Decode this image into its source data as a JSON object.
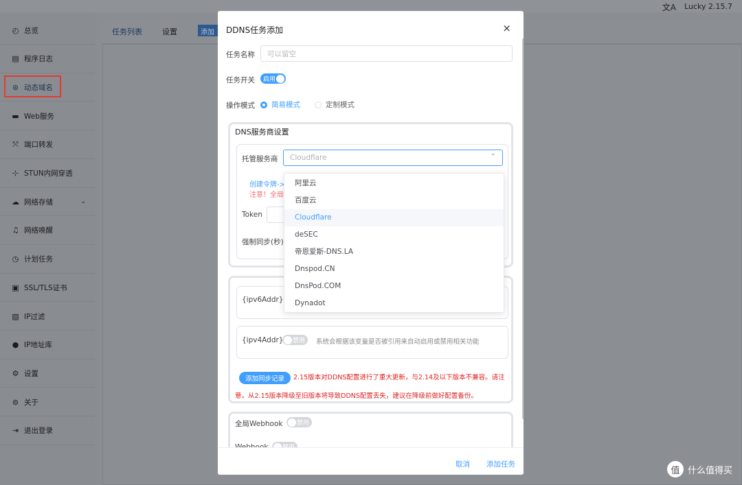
{
  "topbar": {
    "lang_icon": "文A",
    "version": "Lucky 2.15.7"
  },
  "sidebar": {
    "items": [
      {
        "label": "总览",
        "icon": "dashboard-icon",
        "glyph": "◴"
      },
      {
        "label": "程序日志",
        "icon": "log-icon",
        "glyph": "▤"
      },
      {
        "label": "动态域名",
        "icon": "dns-icon",
        "glyph": "⊛"
      },
      {
        "label": "Web服务",
        "icon": "web-icon",
        "glyph": "▬"
      },
      {
        "label": "端口转发",
        "icon": "port-forward-icon",
        "glyph": "⤧"
      },
      {
        "label": "STUN内网穿透",
        "icon": "stun-icon",
        "glyph": "⊹"
      },
      {
        "label": "网络存储",
        "icon": "cloud-icon",
        "glyph": "☁"
      },
      {
        "label": "网络唤醒",
        "icon": "bell-icon",
        "glyph": "♫"
      },
      {
        "label": "计划任务",
        "icon": "clock-icon",
        "glyph": "◷"
      },
      {
        "label": "SSL/TLS证书",
        "icon": "certificate-icon",
        "glyph": "▣"
      },
      {
        "label": "IP过滤",
        "icon": "filter-icon",
        "glyph": "▧"
      },
      {
        "label": "IP地址库",
        "icon": "user-icon",
        "glyph": "●"
      },
      {
        "label": "设置",
        "icon": "gear-icon",
        "glyph": "⚙"
      },
      {
        "label": "关于",
        "icon": "about-icon",
        "glyph": "⊚"
      },
      {
        "label": "退出登录",
        "icon": "logout-icon",
        "glyph": "⇥"
      }
    ],
    "expand_glyph": "⌄"
  },
  "tabs": {
    "list": "任务列表",
    "settings": "设置",
    "add": "添加任务"
  },
  "dialog": {
    "title": "DDNS任务添加",
    "close": "×",
    "task_name_label": "任务名称",
    "task_name_placeholder": "可以留空",
    "task_switch_label": "任务开关",
    "task_switch_text": "启用",
    "mode_label": "操作模式",
    "mode_simple": "简易模式",
    "mode_custom": "定制模式",
    "dns_section_title": "DNS服务商设置",
    "provider_label": "托管服务商",
    "provider_value": "Cloudflare",
    "caret": "⌃",
    "create_token_link": "创建令牌->",
    "notice_text": "注意！全局",
    "token_label": "Token",
    "force_sync_label": "强制同步(秒)",
    "ipv6_label": "{ipv6Addr}",
    "ipv4_label": "{ipv4Addr}",
    "ipv4_switch_text": "禁用",
    "ipv4_hint": "系统会根据该变量是否被引用来自动启用或禁用相关功能",
    "add_sync_record": "添加同步记录",
    "version_warning_1": "2.15版本对DDNS配置进行了重大更新，与2.14及以下版本不兼容。请注",
    "version_warning_2": "意，从2.15版本降级至旧版本将导致DDNS配置丢失，建议在降级前做好配置备份。",
    "global_webhook_label": "全局Webhook",
    "webhook_label": "Webhook",
    "off_text": "禁用",
    "cancel": "取消",
    "submit": "添加任务"
  },
  "provider_options": [
    "阿里云",
    "百度云",
    "Cloudflare",
    "deSEC",
    "帝恩爱斯-DNS.LA",
    "Dnspod.CN",
    "DnsPod.COM",
    "Dynadot"
  ],
  "selected_provider": "Cloudflare",
  "watermark": {
    "logo": "值",
    "text": "什么值得买"
  },
  "colors": {
    "accent": "#409eff",
    "danger": "#f56c6c",
    "highlight_box": "#e53935"
  }
}
